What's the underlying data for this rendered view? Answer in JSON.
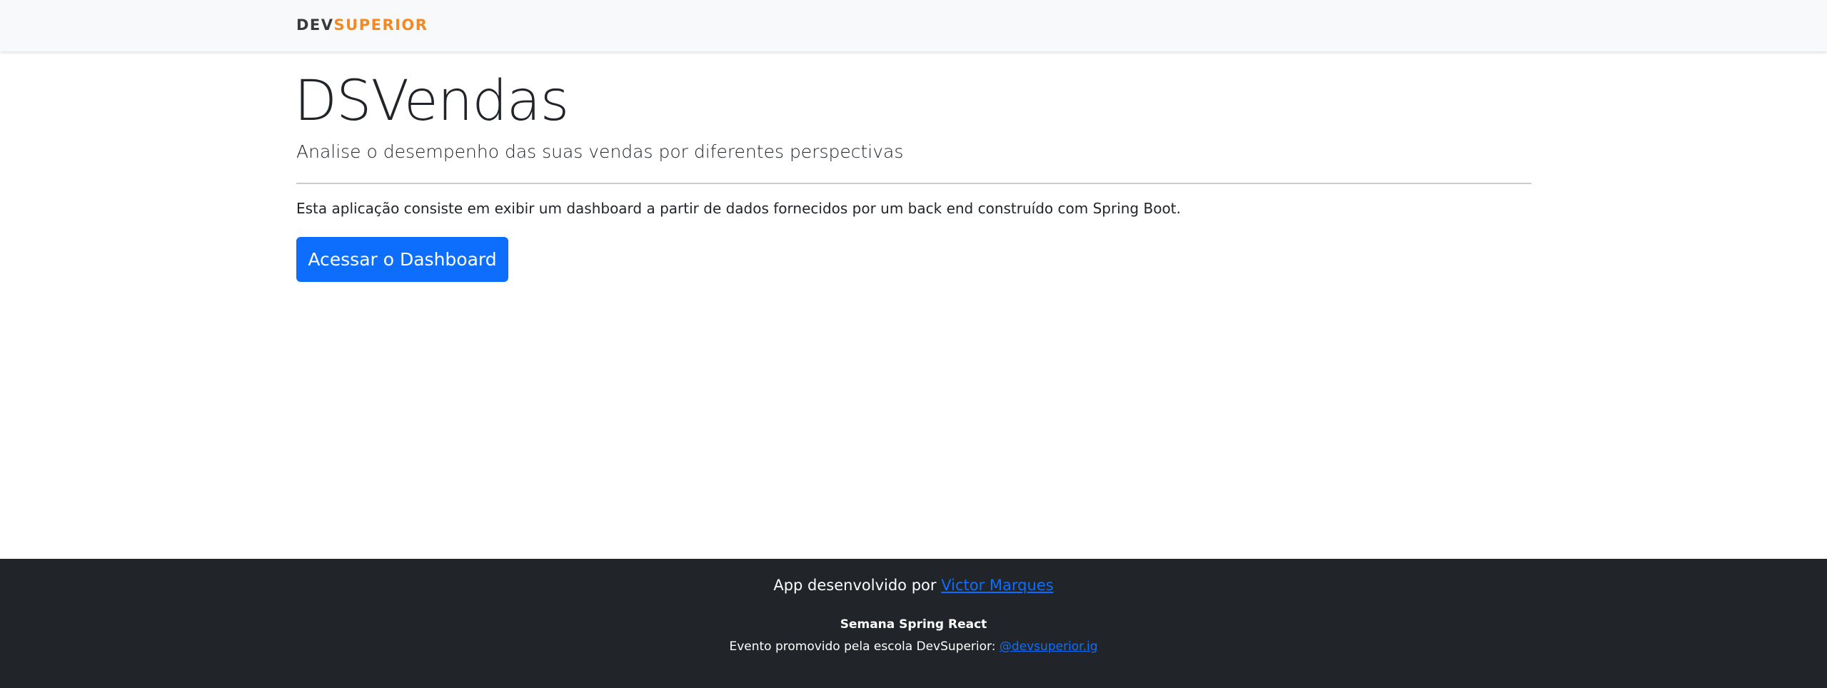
{
  "navbar": {
    "logo_part1": "DEV",
    "logo_part2": "SUPERIOR",
    "logo_colors": {
      "dev": "#3a3a3a",
      "superior": "#f5881f"
    }
  },
  "main": {
    "title": "DSVendas",
    "lead": "Analise o desempenho das suas vendas por diferentes perspectivas",
    "description": "Esta aplicação consiste em exibir um dashboard a partir de dados fornecidos por um back end construído com Spring Boot.",
    "cta_label": "Acessar o Dashboard",
    "cta_color": "#0d6efd"
  },
  "footer": {
    "developed_by_prefix": "App desenvolvido por ",
    "developer_name": "Victor Marques",
    "event_name": "Semana Spring React",
    "promoted_by_prefix": "Evento promovido pela escola DevSuperior: ",
    "instagram_handle": "@devsuperior.ig",
    "background": "#212529"
  }
}
